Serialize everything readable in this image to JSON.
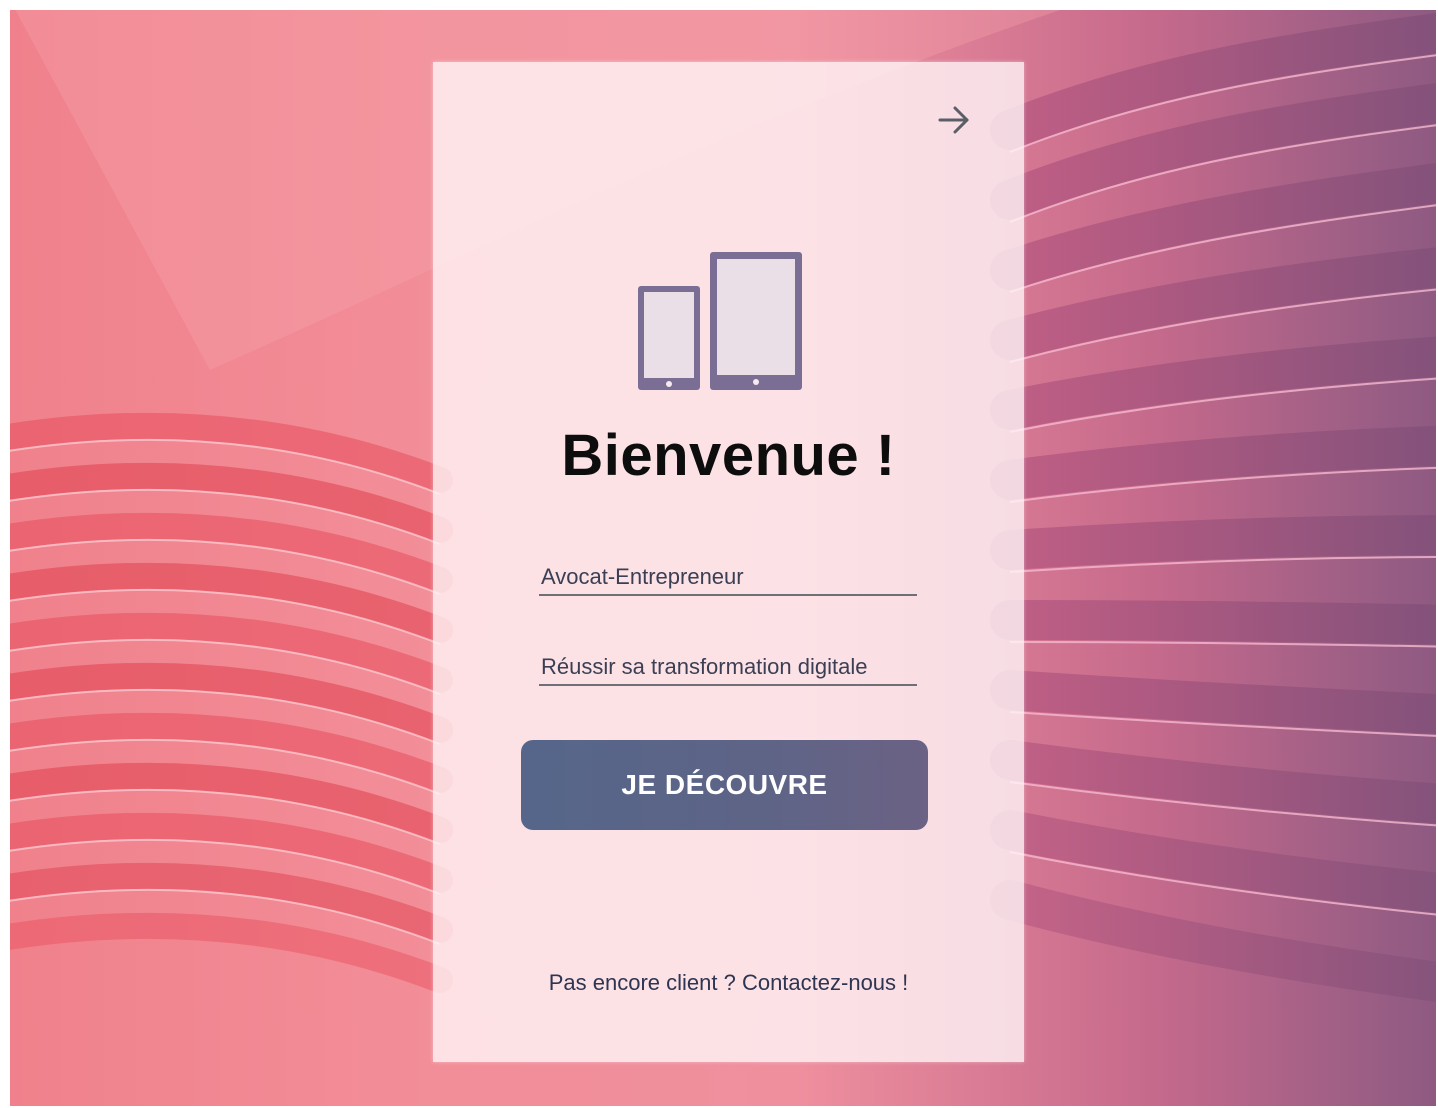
{
  "theme": {
    "button_color": "#5a6688",
    "icon_color": "#7b6e94",
    "text_color": "#0d0d0d"
  },
  "header": {
    "exit_icon": "arrow-right-icon"
  },
  "hero": {
    "icon": "devices-icon",
    "title": "Bienvenue !"
  },
  "form": {
    "field_1_value": "Avocat-Entrepreneur",
    "field_2_value": "Réussir sa transformation digitale",
    "submit_label": "JE DÉCOUVRE"
  },
  "footer": {
    "prompt": "Pas encore client ?",
    "link_label": "Contactez-nous !"
  }
}
